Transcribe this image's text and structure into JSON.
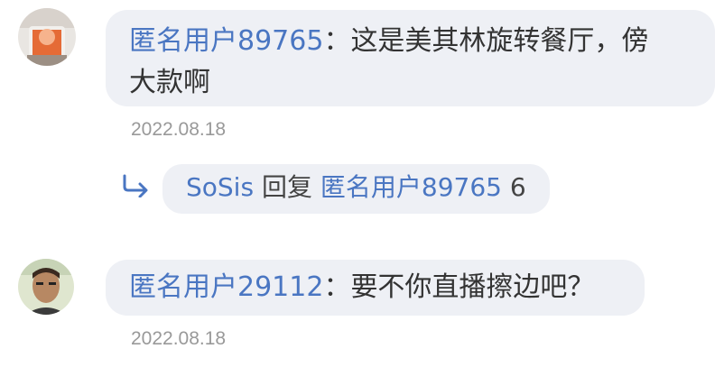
{
  "comments": [
    {
      "username": "匿名用户89765",
      "separator": "：",
      "text_line1": "这是美其林旋转餐厅，傍",
      "text_line2": "大款啊",
      "date": "2022.08.18",
      "reply": {
        "user": "SoSis",
        "word": "回复",
        "target": "匿名用户89765",
        "text": "6"
      }
    },
    {
      "username": "匿名用户29112",
      "separator": "：",
      "text": "要不你直播擦边吧？",
      "date": "2022.08.18"
    }
  ],
  "icons": {
    "reply": "reply-arrow-icon",
    "accent_color": "#4a76c2",
    "bubble_color": "#eef0f5"
  }
}
